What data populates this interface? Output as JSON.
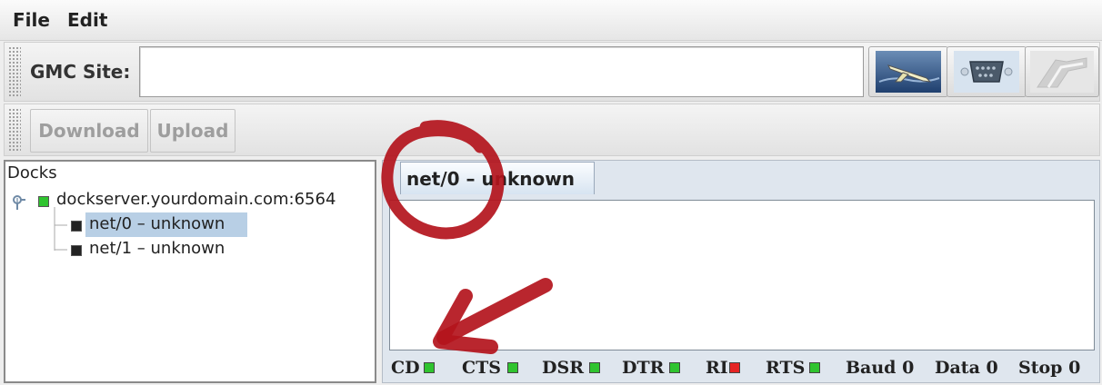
{
  "menu": {
    "file": "File",
    "edit": "Edit"
  },
  "site": {
    "label": "GMC Site:",
    "value": ""
  },
  "toolbar": {
    "download": "Download",
    "upload": "Upload"
  },
  "tree": {
    "root": "Docks",
    "server": "dockserver.yourdomain.com:6564",
    "children": [
      "net/0 – unknown",
      "net/1 – unknown"
    ]
  },
  "tab": {
    "label": "net/0 – unknown"
  },
  "status": [
    {
      "label": "CD",
      "color": "#2fc42f"
    },
    {
      "label": "CTS",
      "color": "#2fc42f"
    },
    {
      "label": "DSR",
      "color": "#2fc42f"
    },
    {
      "label": "DTR",
      "color": "#2fc42f"
    },
    {
      "label": "RI",
      "color": "#e52424"
    },
    {
      "label": "RTS",
      "color": "#2fc42f"
    }
  ],
  "readouts": {
    "baud": "Baud 0",
    "data": "Data 0",
    "stop": "Stop 0"
  },
  "colors": {
    "server_led": "#2fc42f",
    "node_led": "#222222",
    "selection": "#b8cfe5",
    "annotation": "#b3141c"
  },
  "icons": [
    "glider-icon",
    "serial-port-icon",
    "connect-icon"
  ]
}
